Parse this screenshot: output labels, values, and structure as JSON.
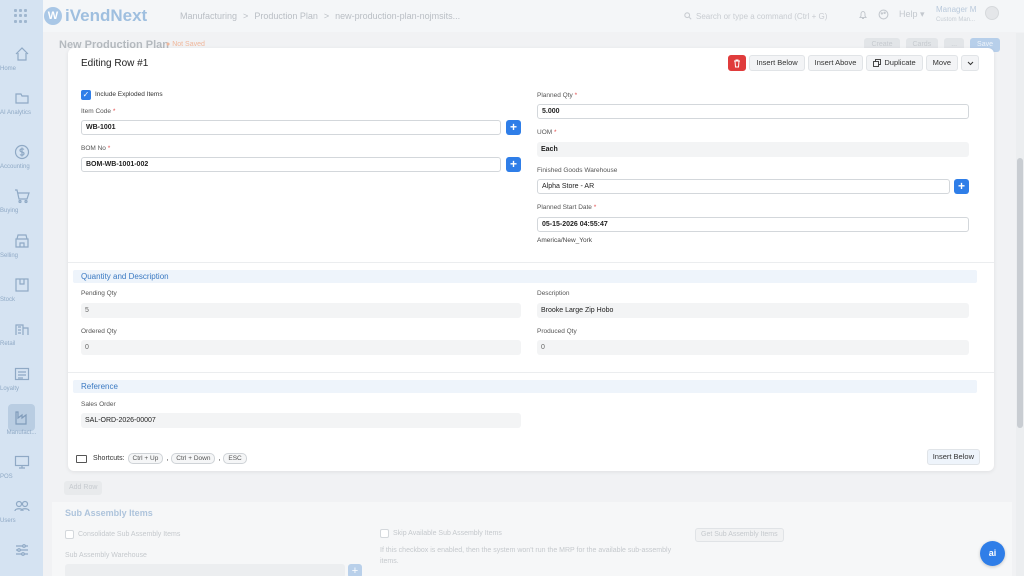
{
  "app": {
    "logo_text": "iVendNext",
    "logo_mark": "W"
  },
  "breadcrumbs": [
    "Manufacturing",
    ">",
    "Production Plan",
    ">",
    "new-production-plan-nojmsits..."
  ],
  "search": {
    "placeholder": "Search or type a command (Ctrl + G)"
  },
  "topbar": {
    "help_label": "Help",
    "user_name": "Manager M",
    "user_sub": "Custom Man..."
  },
  "sidebar": {
    "items": [
      {
        "label": "Home",
        "icon": "home-icon"
      },
      {
        "label": "AI Analytics",
        "icon": "folder-icon"
      },
      {
        "label": "Accounting",
        "icon": "dollar-icon"
      },
      {
        "label": "Buying",
        "icon": "cart-icon"
      },
      {
        "label": "Selling",
        "icon": "store-icon"
      },
      {
        "label": "Stock",
        "icon": "box-icon"
      },
      {
        "label": "Retail",
        "icon": "building-icon"
      },
      {
        "label": "Loyalty",
        "icon": "loyalty-icon"
      },
      {
        "label": "Manufact...",
        "icon": "factory-icon"
      },
      {
        "label": "POS",
        "icon": "monitor-icon"
      },
      {
        "label": "Users",
        "icon": "users-icon"
      },
      {
        "label": "",
        "icon": "sliders-icon"
      }
    ]
  },
  "page": {
    "title": "New Production Plan",
    "status": "Not Saved",
    "buttons": [
      "Create",
      "Cards",
      "...",
      "Save"
    ],
    "add_row": "Add Row"
  },
  "background": {
    "section": "Sub Assembly Items",
    "consolidate": "Consolidate Sub Assembly Items",
    "skip_available": "Skip Available Sub Assembly Items",
    "skip_hint": "If this checkbox is enabled, then the system won't run the MRP for the available sub-assembly items.",
    "get_button": "Get Sub Assembly Items",
    "warehouse_label": "Sub Assembly Warehouse"
  },
  "modal": {
    "title": "Editing Row #1",
    "actions": {
      "insert_below": "Insert Below",
      "insert_above": "Insert Above",
      "duplicate": "Duplicate",
      "move": "Move"
    },
    "include_exploded": "Include Exploded Items",
    "item_code_label": "Item Code",
    "item_code_value": "WB-1001",
    "bom_no_label": "BOM No",
    "bom_no_value": "BOM-WB-1001-002",
    "planned_qty_label": "Planned Qty",
    "planned_qty_value": "5.000",
    "uom_label": "UOM",
    "uom_value": "Each",
    "fg_warehouse_label": "Finished Goods Warehouse",
    "fg_warehouse_value": "Alpha Store - AR",
    "planned_start_label": "Planned Start Date",
    "planned_start_value": "05-15-2026 04:55:47",
    "timezone": "America/New_York",
    "section_qty": "Quantity and Description",
    "pending_qty_label": "Pending Qty",
    "pending_qty_value": "5",
    "description_label": "Description",
    "description_value": "Brooke Large Zip Hobo",
    "ordered_qty_label": "Ordered Qty",
    "ordered_qty_value": "0",
    "produced_qty_label": "Produced Qty",
    "produced_qty_value": "0",
    "section_ref": "Reference",
    "sales_order_label": "Sales Order",
    "sales_order_value": "SAL-ORD-2026-00007",
    "shortcuts_label": "Shortcuts:",
    "shortcuts": [
      "Ctrl + Up",
      "Ctrl + Down",
      "ESC"
    ],
    "footer_insert_below": "Insert Below"
  },
  "ai_button": "ai",
  "colors": {
    "accent": "#2f7ee8",
    "danger": "#e03c3c",
    "section_bg": "#eef4fb",
    "section_text": "#3a79c2"
  }
}
